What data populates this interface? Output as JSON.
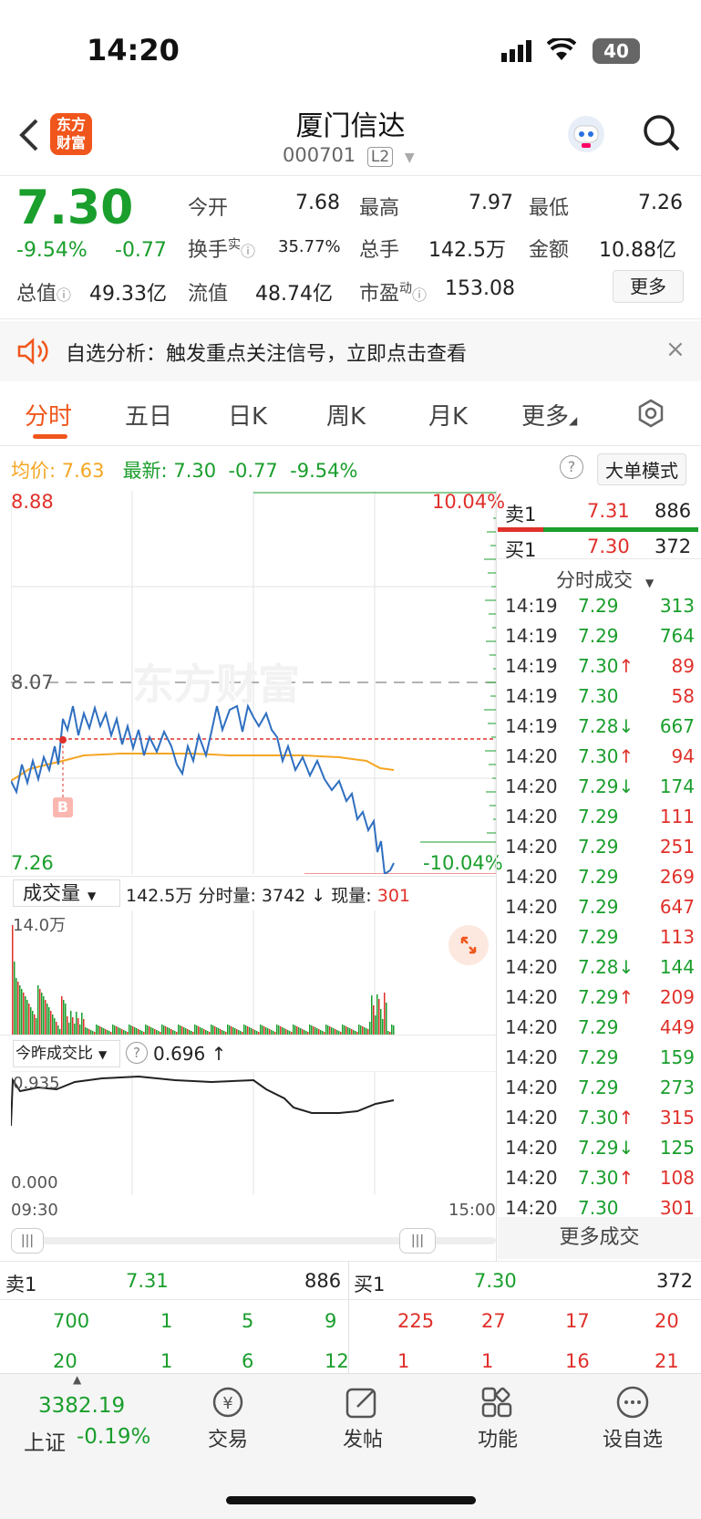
{
  "status": {
    "time": "14:20",
    "battery": "40"
  },
  "header": {
    "title": "厦门信达",
    "code": "000701",
    "level": "L2",
    "logo_line1": "东方",
    "logo_line2": "财富"
  },
  "quote": {
    "price": "7.30",
    "pct": "-9.54%",
    "chg": "-0.77",
    "open_label": "今开",
    "open": "7.68",
    "high_label": "最高",
    "high": "7.97",
    "low_label": "最低",
    "low": "7.26",
    "turnover_label": "换手",
    "turnover_sup": "实",
    "turnover": "35.77%",
    "vol_label": "总手",
    "vol": "142.5万",
    "amount_label": "金额",
    "amount": "10.88亿",
    "mcap_label": "总值",
    "mcap": "49.33亿",
    "float_label": "流值",
    "float": "48.74亿",
    "pe_label": "市盈",
    "pe_sup": "动",
    "pe": "153.08",
    "more": "更多"
  },
  "banner": {
    "text": "自选分析：触发重点关注信号，立即点击查看"
  },
  "tabs": [
    "分时",
    "五日",
    "日K",
    "周K",
    "月K",
    "更多"
  ],
  "info": {
    "avg_label": "均价:",
    "avg": "7.63",
    "last_label": "最新:",
    "last": "7.30",
    "chg": "-0.77",
    "pct": "-9.54%",
    "mode": "大单模式"
  },
  "chart": {
    "top": "8.88",
    "top_pct": "10.04%",
    "mid": "8.07",
    "bottom": "7.26",
    "bottom_pct": "-10.04%",
    "marker": "B",
    "watermark": "东方财富"
  },
  "volume": {
    "selector": "成交量",
    "total": "142.5万",
    "min_label": "分时量:",
    "min_vol": "3742",
    "arrow": "↓",
    "now_label": "现量:",
    "now": "301",
    "max": "14.0万"
  },
  "ratio": {
    "selector": "今昨成交比",
    "value": "0.696",
    "arrow": "↑",
    "top": "0.935",
    "bottom": "0.000"
  },
  "time_axis": {
    "start": "09:30",
    "end": "15:00"
  },
  "side": {
    "ask1_label": "卖1",
    "ask1_price": "7.31",
    "ask1_vol": "886",
    "bid1_label": "买1",
    "bid1_price": "7.30",
    "bid1_vol": "372",
    "trades_title": "分时成交",
    "more_trades": "更多成交"
  },
  "trades": [
    {
      "t": "14:19",
      "p": "7.29",
      "a": "",
      "v": "313",
      "c": "g"
    },
    {
      "t": "14:19",
      "p": "7.29",
      "a": "",
      "v": "764",
      "c": "g"
    },
    {
      "t": "14:19",
      "p": "7.30",
      "a": "↑",
      "v": "89",
      "c": "r"
    },
    {
      "t": "14:19",
      "p": "7.30",
      "a": "",
      "v": "58",
      "c": "r"
    },
    {
      "t": "14:19",
      "p": "7.28",
      "a": "↓",
      "v": "667",
      "c": "g"
    },
    {
      "t": "14:20",
      "p": "7.30",
      "a": "↑",
      "v": "94",
      "c": "r"
    },
    {
      "t": "14:20",
      "p": "7.29",
      "a": "↓",
      "v": "174",
      "c": "g"
    },
    {
      "t": "14:20",
      "p": "7.29",
      "a": "",
      "v": "111",
      "c": "r"
    },
    {
      "t": "14:20",
      "p": "7.29",
      "a": "",
      "v": "251",
      "c": "r"
    },
    {
      "t": "14:20",
      "p": "7.29",
      "a": "",
      "v": "269",
      "c": "r"
    },
    {
      "t": "14:20",
      "p": "7.29",
      "a": "",
      "v": "647",
      "c": "r"
    },
    {
      "t": "14:20",
      "p": "7.29",
      "a": "",
      "v": "113",
      "c": "r"
    },
    {
      "t": "14:20",
      "p": "7.28",
      "a": "↓",
      "v": "144",
      "c": "g"
    },
    {
      "t": "14:20",
      "p": "7.29",
      "a": "↑",
      "v": "209",
      "c": "r"
    },
    {
      "t": "14:20",
      "p": "7.29",
      "a": "",
      "v": "449",
      "c": "r"
    },
    {
      "t": "14:20",
      "p": "7.29",
      "a": "",
      "v": "159",
      "c": "g"
    },
    {
      "t": "14:20",
      "p": "7.29",
      "a": "",
      "v": "273",
      "c": "g"
    },
    {
      "t": "14:20",
      "p": "7.30",
      "a": "↑",
      "v": "315",
      "c": "r"
    },
    {
      "t": "14:20",
      "p": "7.29",
      "a": "↓",
      "v": "125",
      "c": "g"
    },
    {
      "t": "14:20",
      "p": "7.30",
      "a": "↑",
      "v": "108",
      "c": "r"
    },
    {
      "t": "14:20",
      "p": "7.30",
      "a": "",
      "v": "301",
      "c": "r"
    }
  ],
  "book": {
    "ask_label": "卖1",
    "ask_price": "7.31",
    "ask_vol": "886",
    "bid_label": "买1",
    "bid_price": "7.30",
    "bid_vol": "372",
    "ask_rows": [
      [
        "700",
        "1",
        "5",
        "9"
      ],
      [
        "20",
        "1",
        "6",
        "12"
      ]
    ],
    "bid_rows": [
      [
        "225",
        "27",
        "17",
        "20"
      ],
      [
        "1",
        "1",
        "16",
        "21"
      ]
    ]
  },
  "nav": {
    "index_value": "3382.19",
    "index_name": "上证",
    "index_pct": "-0.19%",
    "trade": "交易",
    "post": "发帖",
    "func": "功能",
    "watch": "设自选"
  },
  "colors": {
    "up": "#e0302a",
    "down": "#1a9e2c",
    "avg": "#f5a623",
    "price_line": "#2f6fc0",
    "accent": "#f0561c"
  }
}
